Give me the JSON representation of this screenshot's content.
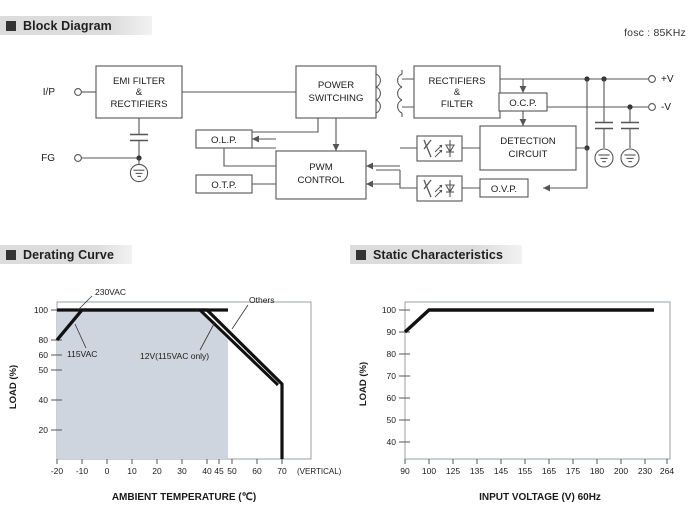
{
  "sections": {
    "block_diagram": {
      "title": "Block Diagram"
    },
    "derating": {
      "title": "Derating Curve"
    },
    "static": {
      "title": "Static Characteristics"
    }
  },
  "block_diagram": {
    "fosc_label": "fosc : 85KHz",
    "terminals": [
      {
        "name": "input",
        "label": "I/P"
      },
      {
        "name": "frame-ground",
        "label": "FG"
      },
      {
        "name": "output-positive",
        "label": "+V"
      },
      {
        "name": "output-negative",
        "label": "-V"
      }
    ],
    "blocks": [
      {
        "name": "emi-filter-rectifiers",
        "lines": [
          "EMI FILTER",
          "&",
          "RECTIFIERS"
        ]
      },
      {
        "name": "power-switching",
        "lines": [
          "POWER",
          "SWITCHING"
        ]
      },
      {
        "name": "rectifiers-filter",
        "lines": [
          "RECTIFIERS",
          "&",
          "FILTER"
        ]
      },
      {
        "name": "olp",
        "lines": [
          "O.L.P."
        ]
      },
      {
        "name": "otp",
        "lines": [
          "O.T.P."
        ]
      },
      {
        "name": "pwm-control",
        "lines": [
          "PWM",
          "CONTROL"
        ]
      },
      {
        "name": "ocp",
        "lines": [
          "O.C.P."
        ]
      },
      {
        "name": "detection-circuit",
        "lines": [
          "DETECTION",
          "CIRCUIT"
        ]
      },
      {
        "name": "ovp",
        "lines": [
          "O.V.P."
        ]
      }
    ]
  },
  "chart_data": [
    {
      "name": "derating-curve",
      "type": "line",
      "title": "Derating Curve",
      "xlabel": "AMBIENT TEMPERATURE (℃)",
      "ylabel": "LOAD (%)",
      "xlim": [
        -20,
        75
      ],
      "ylim": [
        0,
        108
      ],
      "xticks": [
        -20,
        -10,
        0,
        10,
        20,
        30,
        40,
        45,
        50,
        60,
        70
      ],
      "yticks": [
        20,
        40,
        50,
        60,
        80,
        100
      ],
      "grid": false,
      "note": "(VERTICAL)",
      "annotations": [
        {
          "name": "ann-230vac",
          "text": "230VAC"
        },
        {
          "name": "ann-115vac",
          "text": "115VAC"
        },
        {
          "name": "ann-others",
          "text": "Others"
        },
        {
          "name": "ann-12v",
          "text": "12V(115VAC only)"
        }
      ],
      "series": [
        {
          "name": "Others",
          "x": [
            -20,
            -10,
            50,
            70,
            70
          ],
          "y": [
            80,
            100,
            100,
            50,
            0
          ]
        },
        {
          "name": "12V(115VAC only)",
          "x": [
            -20,
            -10,
            45,
            70,
            70
          ],
          "y": [
            80,
            100,
            100,
            50,
            0
          ]
        },
        {
          "name": "230VAC",
          "x": [
            -20,
            50
          ],
          "y": [
            100,
            100
          ]
        }
      ],
      "fill_color": "#ced5de"
    },
    {
      "name": "static-characteristics",
      "type": "line",
      "title": "Static Characteristics",
      "xlabel": "INPUT VOLTAGE (V) 60Hz",
      "ylabel": "LOAD (%)",
      "ylim": [
        30,
        108
      ],
      "xticks": [
        90,
        100,
        125,
        135,
        145,
        155,
        165,
        175,
        180,
        200,
        230,
        264
      ],
      "yticks": [
        40,
        50,
        60,
        70,
        80,
        90,
        100
      ],
      "grid": false,
      "series": [
        {
          "name": "load",
          "x": [
            90,
            100,
            264
          ],
          "y": [
            90,
            100,
            100
          ]
        }
      ]
    }
  ]
}
